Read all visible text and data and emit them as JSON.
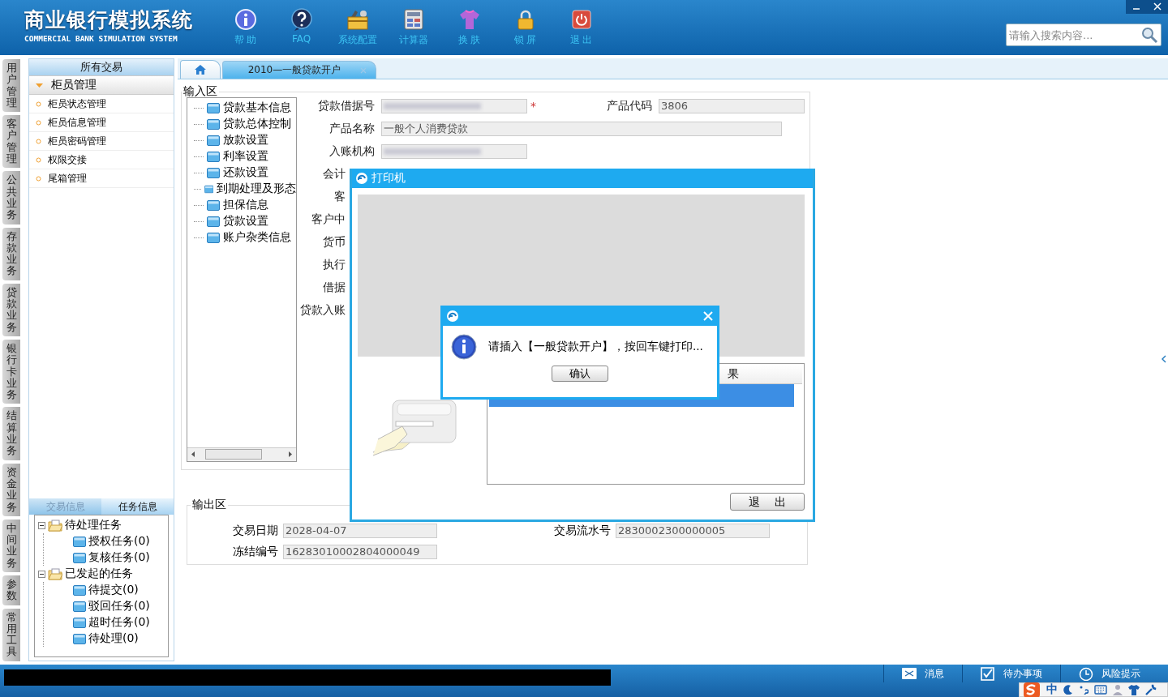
{
  "header": {
    "title": "商业银行模拟系统",
    "subtitle": "COMMERCIAL BANK SIMULATION SYSTEM",
    "toolbar": [
      {
        "label": "帮 助"
      },
      {
        "label": "FAQ"
      },
      {
        "label": "系统配置"
      },
      {
        "label": "计算器"
      },
      {
        "label": "换 肤"
      },
      {
        "label": "锁 屏"
      },
      {
        "label": "退 出"
      }
    ],
    "search": {
      "placeholder": "请输入搜索内容..."
    }
  },
  "side_tabs": [
    "用户管理",
    "客户管理",
    "公共业务",
    "存款业务",
    "贷款业务",
    "银行卡业务",
    "结算业务",
    "资金业务",
    "中间业务",
    "参数",
    "常用工具"
  ],
  "nav": {
    "title": "所有交易",
    "group": {
      "label": "柜员管理",
      "expanded": true,
      "items": [
        "柜员状态管理",
        "柜员信息管理",
        "柜员密码管理",
        "权限交接",
        "尾箱管理"
      ]
    }
  },
  "task_panel": {
    "tabs": [
      {
        "label": "交易信息",
        "selected": false
      },
      {
        "label": "任务信息",
        "selected": true
      }
    ],
    "tree": [
      {
        "label": "待处理任务",
        "expanded": true,
        "children": [
          {
            "label": "授权任务(0)"
          },
          {
            "label": "复核任务(0)"
          }
        ]
      },
      {
        "label": "已发起的任务",
        "expanded": true,
        "children": [
          {
            "label": "待提交(0)"
          },
          {
            "label": "驳回任务(0)"
          },
          {
            "label": "超时任务(0)"
          },
          {
            "label": "待处理(0)"
          }
        ]
      }
    ]
  },
  "tabs": [
    {
      "kind": "home",
      "selected": false
    },
    {
      "kind": "page",
      "label": "2010—一般贷款开户",
      "selected": true
    }
  ],
  "input_area": {
    "title": "输入区",
    "required_mark": "*",
    "tree": [
      "贷款基本信息",
      "贷款总体控制",
      "放款设置",
      "利率设置",
      "还款设置",
      "到期处理及形态",
      "担保信息",
      "贷款设置",
      "账户杂类信息"
    ],
    "fields": [
      {
        "label": "贷款借据号",
        "redacted": true,
        "required": true
      },
      {
        "label": "产品代码",
        "value": "3806",
        "redacted": false,
        "required": false
      },
      {
        "label": "产品名称",
        "value": "一般个人消费贷款",
        "redacted": false,
        "required": false
      },
      {
        "label": "入账机构",
        "redacted": true,
        "required": false
      }
    ],
    "covered_labels": [
      "会计",
      "客",
      "客户中",
      "货币",
      "执行",
      "借据",
      "贷款入账"
    ]
  },
  "output_area": {
    "title": "输出区",
    "fields": [
      {
        "label": "交易日期",
        "value": "2028-04-07"
      },
      {
        "label": "交易流水号",
        "value": "2830002300000005"
      },
      {
        "label": "冻结编号",
        "value": "16283010002804000049"
      }
    ]
  },
  "printer_dialog": {
    "title": "打印机",
    "list_header": "果",
    "rows": [
      {
        "selected": true
      }
    ],
    "exit_button": "退 出"
  },
  "message_box": {
    "message": "请插入【一般贷款开户】，按回车键打印...",
    "ok_button": "确认"
  },
  "status_bar": {
    "items": [
      {
        "label": "消息"
      },
      {
        "label": "待办事项"
      },
      {
        "label": "风险提示"
      }
    ],
    "ime": {
      "mode": "中"
    }
  }
}
